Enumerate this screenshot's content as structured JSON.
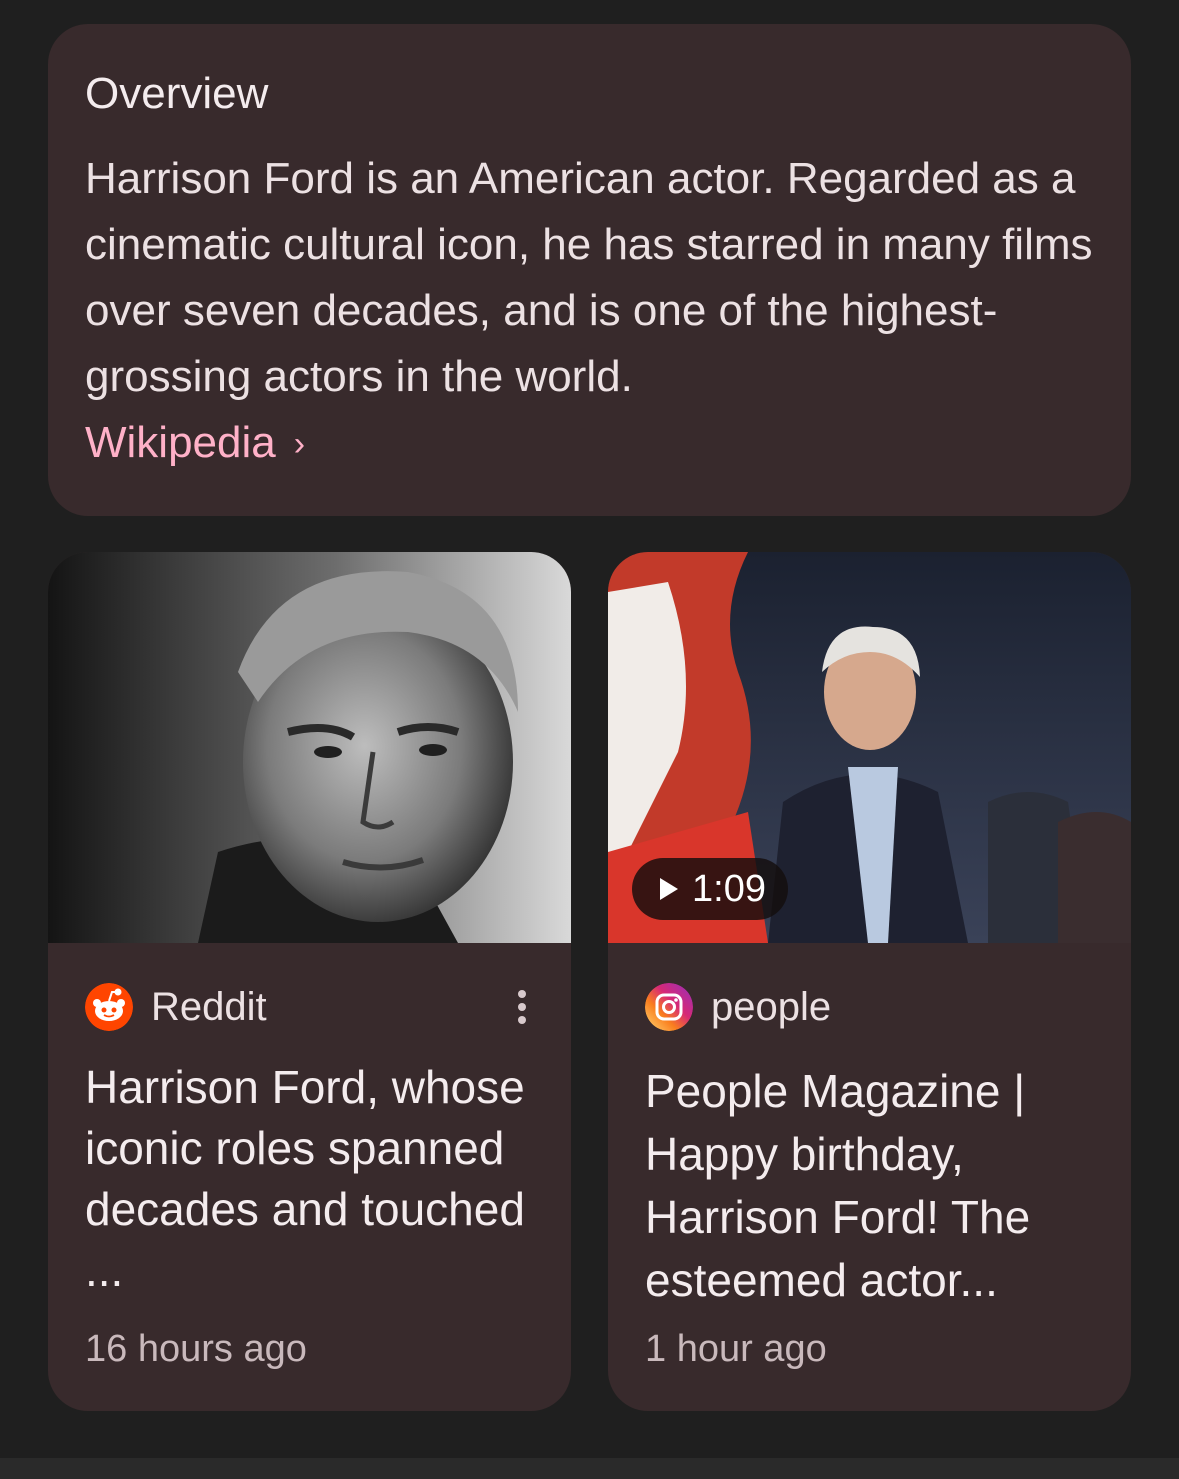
{
  "overview": {
    "title": "Overview",
    "body": "Harrison Ford is an American actor. Regarded as a cinematic cultural icon, he has starred in many films over seven decades, and is one of the highest-grossing actors in the world.",
    "link_label": "Wikipedia",
    "link_chevron": "›"
  },
  "cards": [
    {
      "source": "Reddit",
      "headline": "Harrison Ford, whose iconic roles spanned decades and touched ...",
      "time": "16 hours ago",
      "icon": "reddit-icon"
    },
    {
      "source": "people",
      "headline": "People Magazine | Happy birthday, Harrison Ford! The esteemed actor...",
      "time": "1 hour ago",
      "icon": "instagram-icon",
      "duration": "1:09"
    }
  ],
  "colors": {
    "background": "#1f1f1f",
    "card": "#382a2c",
    "link": "#ffb1c8",
    "text": "#ece1e3"
  }
}
